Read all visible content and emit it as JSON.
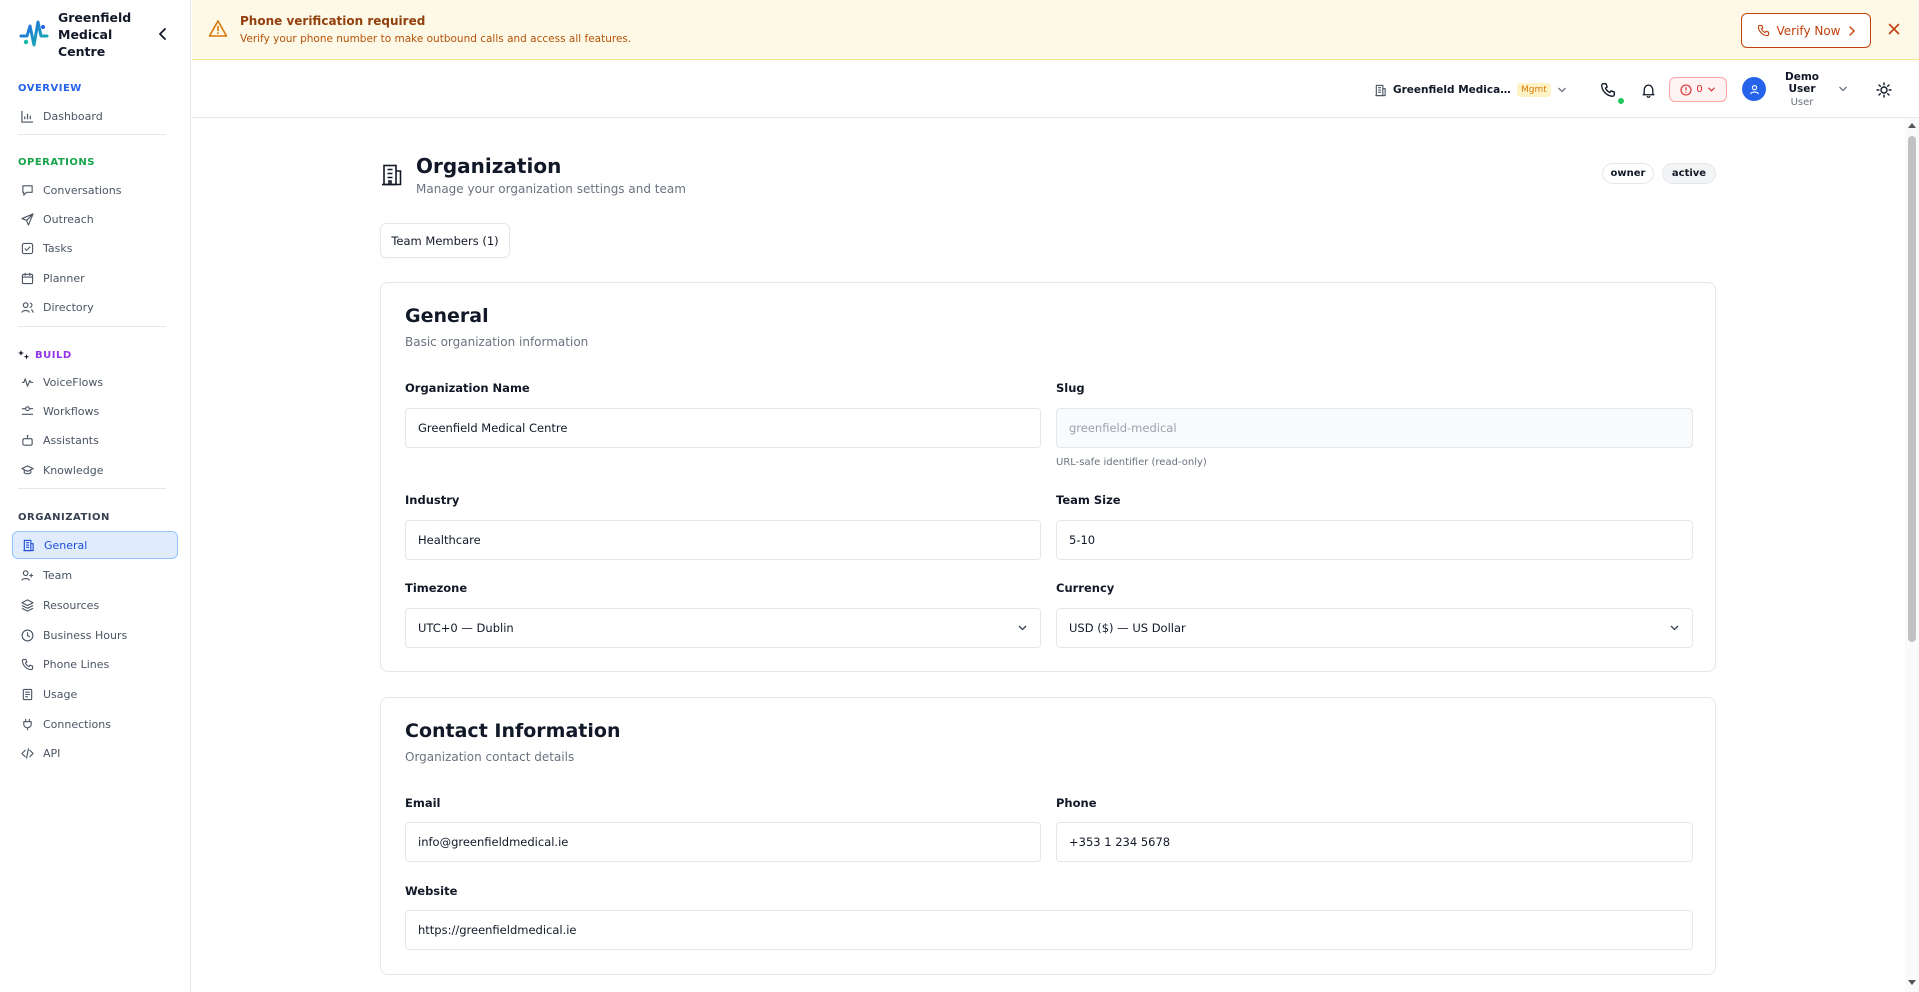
{
  "brand": {
    "name": "Greenfield Medical Centre"
  },
  "sidebar": {
    "sections": {
      "overview": "OVERVIEW",
      "operations": "OPERATIONS",
      "build": "BUILD",
      "organization": "ORGANIZATION"
    },
    "items": {
      "dashboard": "Dashboard",
      "conversations": "Conversations",
      "outreach": "Outreach",
      "tasks": "Tasks",
      "planner": "Planner",
      "directory": "Directory",
      "voiceflows": "VoiceFlows",
      "workflows": "Workflows",
      "assistants": "Assistants",
      "knowledge": "Knowledge",
      "general": "General",
      "team": "Team",
      "resources": "Resources",
      "business_hours": "Business Hours",
      "phone_lines": "Phone Lines",
      "usage": "Usage",
      "connections": "Connections",
      "api": "API"
    },
    "active": "general",
    "colors": {
      "overview": "#2563eb",
      "operations": "#16a34a",
      "build": "#9333ea",
      "organization": "#374151"
    }
  },
  "banner": {
    "title": "Phone verification required",
    "subtitle": "Verify your phone number to make outbound calls and access all features.",
    "verify_label": "Verify Now"
  },
  "header": {
    "org_name": "Greenfield Medical Centre",
    "org_badge": "Mgmt",
    "alert_count": "0",
    "user_name": "Demo User",
    "user_role": "User"
  },
  "page": {
    "title": "Organization",
    "subtitle": "Manage your organization settings and team",
    "badges": {
      "owner": "owner",
      "active": "active"
    },
    "tab_label": "Team Members (1)"
  },
  "general": {
    "title": "General",
    "subtitle": "Basic organization information",
    "org_name_label": "Organization Name",
    "org_name_value": "Greenfield Medical Centre",
    "slug_label": "Slug",
    "slug_value": "greenfield-medical",
    "slug_hint": "URL-safe identifier (read-only)",
    "industry_label": "Industry",
    "industry_value": "Healthcare",
    "team_size_label": "Team Size",
    "team_size_value": "5-10",
    "timezone_label": "Timezone",
    "timezone_value": "UTC+0 — Dublin",
    "currency_label": "Currency",
    "currency_value": "USD ($) — US Dollar"
  },
  "contact": {
    "title": "Contact Information",
    "subtitle": "Organization contact details",
    "email_label": "Email",
    "email_value": "info@greenfieldmedical.ie",
    "phone_label": "Phone",
    "phone_value": "+353 1 234 5678",
    "website_label": "Website",
    "website_value": "https://greenfieldmedical.ie"
  }
}
